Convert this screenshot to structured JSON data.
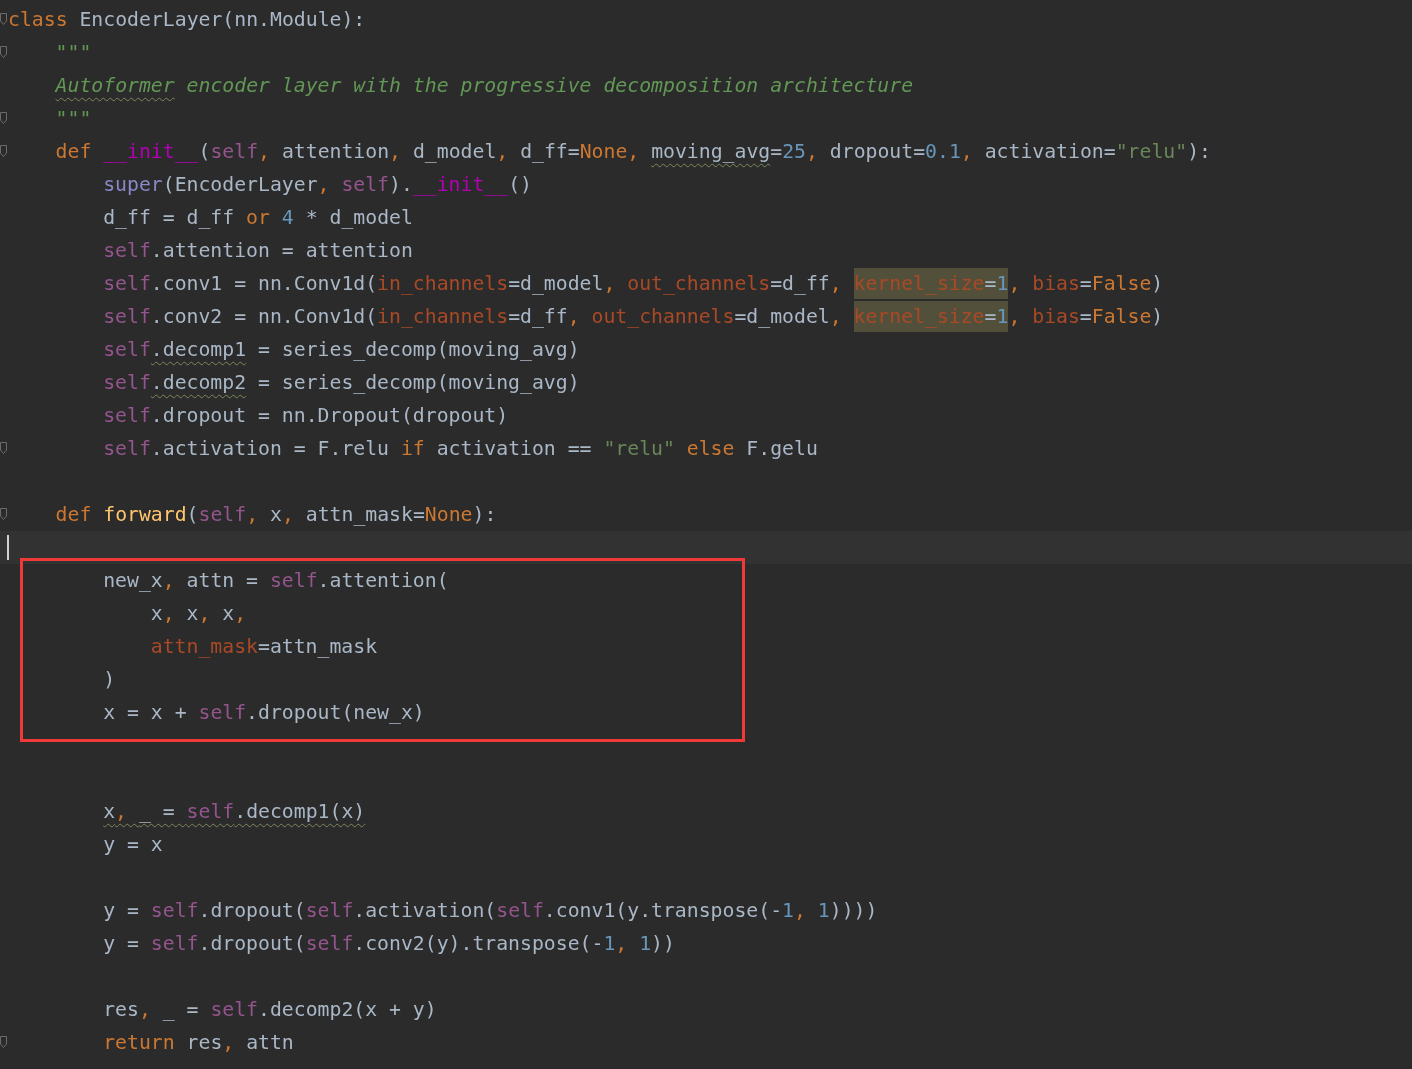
{
  "editor": {
    "lines": [
      {
        "kind": "line",
        "current": false,
        "fold": true,
        "tokens": [
          {
            "kind": "kw",
            "text": "class"
          },
          {
            "kind": "plain",
            "text": " EncoderLayer(nn.Module):"
          }
        ],
        "children": [
          {
            "kind": "line",
            "current": false,
            "fold": true,
            "tokens": [
              {
                "kind": "doc",
                "text": "\"\"\""
              }
            ]
          },
          {
            "kind": "line",
            "current": false,
            "fold": false,
            "tokens": [
              {
                "kind": "doc",
                "text": "Autoformer",
                "warning": true
              },
              {
                "kind": "doc",
                "text": " encoder layer with the progressive decomposition architecture"
              }
            ]
          },
          {
            "kind": "line",
            "current": false,
            "fold": true,
            "tokens": [
              {
                "kind": "doc",
                "text": "\"\"\""
              }
            ]
          },
          {
            "kind": "line",
            "current": false,
            "fold": true,
            "tokens": [
              {
                "kind": "kw",
                "text": "def "
              },
              {
                "kind": "dunder",
                "text": "__init__"
              },
              {
                "kind": "plain",
                "text": "("
              },
              {
                "kind": "self",
                "text": "self"
              },
              {
                "kind": "kw",
                "text": ", "
              },
              {
                "kind": "plain",
                "text": "attention"
              },
              {
                "kind": "kw",
                "text": ", "
              },
              {
                "kind": "plain",
                "text": "d_model"
              },
              {
                "kind": "kw",
                "text": ", "
              },
              {
                "kind": "plain",
                "text": "d_ff="
              },
              {
                "kind": "kw",
                "text": "None"
              },
              {
                "kind": "kw",
                "text": ", "
              },
              {
                "kind": "plain",
                "text": "moving_avg",
                "warning": true
              },
              {
                "kind": "plain",
                "text": "="
              },
              {
                "kind": "num",
                "text": "25"
              },
              {
                "kind": "kw",
                "text": ", "
              },
              {
                "kind": "plain",
                "text": "dropout="
              },
              {
                "kind": "num",
                "text": "0.1"
              },
              {
                "kind": "kw",
                "text": ", "
              },
              {
                "kind": "plain",
                "text": "activation="
              },
              {
                "kind": "str",
                "text": "\"relu\""
              },
              {
                "kind": "plain",
                "text": "):"
              }
            ],
            "children": [
              {
                "kind": "line",
                "current": false,
                "fold": false,
                "tokens": [
                  {
                    "kind": "builtin",
                    "text": "super"
                  },
                  {
                    "kind": "plain",
                    "text": "(EncoderLayer"
                  },
                  {
                    "kind": "kw",
                    "text": ", "
                  },
                  {
                    "kind": "self",
                    "text": "self"
                  },
                  {
                    "kind": "plain",
                    "text": ")."
                  },
                  {
                    "kind": "dunder",
                    "text": "__init__"
                  },
                  {
                    "kind": "plain",
                    "text": "()"
                  }
                ]
              },
              {
                "kind": "line",
                "current": false,
                "fold": false,
                "tokens": [
                  {
                    "kind": "plain",
                    "text": "d_ff = d_ff "
                  },
                  {
                    "kind": "kw",
                    "text": "or "
                  },
                  {
                    "kind": "num",
                    "text": "4"
                  },
                  {
                    "kind": "plain",
                    "text": " * d_model"
                  }
                ]
              },
              {
                "kind": "line",
                "current": false,
                "fold": false,
                "tokens": [
                  {
                    "kind": "self",
                    "text": "self"
                  },
                  {
                    "kind": "plain",
                    "text": ".attention = attention"
                  }
                ]
              },
              {
                "kind": "line",
                "current": false,
                "fold": false,
                "tokens": [
                  {
                    "kind": "self",
                    "text": "self"
                  },
                  {
                    "kind": "plain",
                    "text": ".conv1 = nn.Conv1d("
                  },
                  {
                    "kind": "param",
                    "text": "in_channels"
                  },
                  {
                    "kind": "plain",
                    "text": "=d_model"
                  },
                  {
                    "kind": "kw",
                    "text": ", "
                  },
                  {
                    "kind": "param",
                    "text": "out_channels"
                  },
                  {
                    "kind": "plain",
                    "text": "=d_ff"
                  },
                  {
                    "kind": "kw",
                    "text": ", "
                  },
                  {
                    "kind": "param",
                    "text": "kernel_size",
                    "highlighted": true
                  },
                  {
                    "kind": "plain",
                    "text": "=",
                    "highlighted": true
                  },
                  {
                    "kind": "num",
                    "text": "1",
                    "highlighted": true
                  },
                  {
                    "kind": "kw",
                    "text": ", "
                  },
                  {
                    "kind": "param",
                    "text": "bias"
                  },
                  {
                    "kind": "plain",
                    "text": "="
                  },
                  {
                    "kind": "kw",
                    "text": "False"
                  },
                  {
                    "kind": "plain",
                    "text": ")"
                  }
                ]
              },
              {
                "kind": "line",
                "current": false,
                "fold": false,
                "tokens": [
                  {
                    "kind": "self",
                    "text": "self"
                  },
                  {
                    "kind": "plain",
                    "text": ".conv2 = nn.Conv1d("
                  },
                  {
                    "kind": "param",
                    "text": "in_channels"
                  },
                  {
                    "kind": "plain",
                    "text": "=d_ff"
                  },
                  {
                    "kind": "kw",
                    "text": ", "
                  },
                  {
                    "kind": "param",
                    "text": "out_channels"
                  },
                  {
                    "kind": "plain",
                    "text": "=d_model"
                  },
                  {
                    "kind": "kw",
                    "text": ", "
                  },
                  {
                    "kind": "param",
                    "text": "kernel_size",
                    "highlighted": true
                  },
                  {
                    "kind": "plain",
                    "text": "=",
                    "highlighted": true
                  },
                  {
                    "kind": "num",
                    "text": "1",
                    "highlighted": true
                  },
                  {
                    "kind": "kw",
                    "text": ", "
                  },
                  {
                    "kind": "param",
                    "text": "bias"
                  },
                  {
                    "kind": "plain",
                    "text": "="
                  },
                  {
                    "kind": "kw",
                    "text": "False"
                  },
                  {
                    "kind": "plain",
                    "text": ")"
                  }
                ]
              },
              {
                "kind": "line",
                "current": false,
                "fold": false,
                "tokens": [
                  {
                    "kind": "self",
                    "text": "self"
                  },
                  {
                    "kind": "plain",
                    "text": ".decomp1",
                    "warning": true
                  },
                  {
                    "kind": "plain",
                    "text": " = series_decomp(moving_avg)"
                  }
                ]
              },
              {
                "kind": "line",
                "current": false,
                "fold": false,
                "tokens": [
                  {
                    "kind": "self",
                    "text": "self"
                  },
                  {
                    "kind": "plain",
                    "text": ".decomp2",
                    "warning": true
                  },
                  {
                    "kind": "plain",
                    "text": " = series_decomp(moving_avg)"
                  }
                ]
              },
              {
                "kind": "line",
                "current": false,
                "fold": false,
                "tokens": [
                  {
                    "kind": "self",
                    "text": "self"
                  },
                  {
                    "kind": "plain",
                    "text": ".dropout = nn.Dropout(dropout)"
                  }
                ]
              },
              {
                "kind": "line",
                "current": false,
                "fold": true,
                "tokens": [
                  {
                    "kind": "self",
                    "text": "self"
                  },
                  {
                    "kind": "plain",
                    "text": ".activation = F.relu "
                  },
                  {
                    "kind": "kw",
                    "text": "if"
                  },
                  {
                    "kind": "plain",
                    "text": " activation == "
                  },
                  {
                    "kind": "str",
                    "text": "\"relu\""
                  },
                  {
                    "kind": "kw",
                    "text": " else"
                  },
                  {
                    "kind": "plain",
                    "text": " F.gelu"
                  }
                ]
              },
              {
                "kind": "line",
                "current": false,
                "fold": false
              }
            ]
          },
          {
            "kind": "line",
            "current": false,
            "fold": true,
            "tokens": [
              {
                "kind": "kw",
                "text": "def "
              },
              {
                "kind": "fn",
                "text": "forward"
              },
              {
                "kind": "plain",
                "text": "("
              },
              {
                "kind": "self",
                "text": "self"
              },
              {
                "kind": "kw",
                "text": ", "
              },
              {
                "kind": "plain",
                "text": "x"
              },
              {
                "kind": "kw",
                "text": ", "
              },
              {
                "kind": "plain",
                "text": "attn_mask="
              },
              {
                "kind": "kw",
                "text": "None"
              },
              {
                "kind": "plain",
                "text": "):"
              }
            ],
            "children": [
              {
                "kind": "line",
                "current": true,
                "fold": false
              },
              {
                "kind": "highlight_box",
                "children": [
                  {
                    "kind": "line",
                    "current": false,
                    "fold": false,
                    "tokens": [
                      {
                        "kind": "plain",
                        "text": "new_x"
                      },
                      {
                        "kind": "kw",
                        "text": ", "
                      },
                      {
                        "kind": "plain",
                        "text": "attn = "
                      },
                      {
                        "kind": "self",
                        "text": "self"
                      },
                      {
                        "kind": "plain",
                        "text": ".attention("
                      }
                    ],
                    "children": [
                      {
                        "kind": "line",
                        "current": false,
                        "fold": false,
                        "tokens": [
                          {
                            "kind": "plain",
                            "text": "x"
                          },
                          {
                            "kind": "kw",
                            "text": ", "
                          },
                          {
                            "kind": "plain",
                            "text": "x"
                          },
                          {
                            "kind": "kw",
                            "text": ", "
                          },
                          {
                            "kind": "plain",
                            "text": "x"
                          },
                          {
                            "kind": "kw",
                            "text": ","
                          }
                        ]
                      },
                      {
                        "kind": "line",
                        "current": false,
                        "fold": false,
                        "tokens": [
                          {
                            "kind": "param",
                            "text": "attn_mask"
                          },
                          {
                            "kind": "plain",
                            "text": "=attn_mask"
                          }
                        ]
                      }
                    ]
                  },
                  {
                    "kind": "line",
                    "current": false,
                    "fold": false,
                    "tokens": [
                      {
                        "kind": "plain",
                        "text": ")"
                      }
                    ]
                  },
                  {
                    "kind": "line",
                    "current": false,
                    "fold": false,
                    "tokens": [
                      {
                        "kind": "plain",
                        "text": "x = x + "
                      },
                      {
                        "kind": "self",
                        "text": "self"
                      },
                      {
                        "kind": "plain",
                        "text": ".dropout(new_x)"
                      }
                    ]
                  }
                ]
              },
              {
                "kind": "line",
                "current": false,
                "fold": false
              },
              {
                "kind": "line",
                "current": false,
                "fold": false
              },
              {
                "kind": "line",
                "current": false,
                "fold": false,
                "tokens": [
                  {
                    "kind": "plain",
                    "text": "x",
                    "warning": true
                  },
                  {
                    "kind": "kw",
                    "text": ", ",
                    "warning": true
                  },
                  {
                    "kind": "plain",
                    "text": "_ = ",
                    "warning": true
                  },
                  {
                    "kind": "self",
                    "text": "self",
                    "warning": true
                  },
                  {
                    "kind": "plain",
                    "text": ".decomp1(x)",
                    "warning": true
                  }
                ]
              },
              {
                "kind": "line",
                "current": false,
                "fold": false,
                "tokens": [
                  {
                    "kind": "plain",
                    "text": "y = x"
                  }
                ]
              },
              {
                "kind": "line",
                "current": false,
                "fold": false
              },
              {
                "kind": "line",
                "current": false,
                "fold": false,
                "tokens": [
                  {
                    "kind": "plain",
                    "text": "y = "
                  },
                  {
                    "kind": "self",
                    "text": "self"
                  },
                  {
                    "kind": "plain",
                    "text": ".dropout("
                  },
                  {
                    "kind": "self",
                    "text": "self"
                  },
                  {
                    "kind": "plain",
                    "text": ".activation("
                  },
                  {
                    "kind": "self",
                    "text": "self"
                  },
                  {
                    "kind": "plain",
                    "text": ".conv1(y.transpose(-"
                  },
                  {
                    "kind": "num",
                    "text": "1"
                  },
                  {
                    "kind": "kw",
                    "text": ", "
                  },
                  {
                    "kind": "num",
                    "text": "1"
                  },
                  {
                    "kind": "plain",
                    "text": "))))"
                  }
                ]
              },
              {
                "kind": "line",
                "current": false,
                "fold": false,
                "tokens": [
                  {
                    "kind": "plain",
                    "text": "y = "
                  },
                  {
                    "kind": "self",
                    "text": "self"
                  },
                  {
                    "kind": "plain",
                    "text": ".dropout("
                  },
                  {
                    "kind": "self",
                    "text": "self"
                  },
                  {
                    "kind": "plain",
                    "text": ".conv2(y).transpose(-"
                  },
                  {
                    "kind": "num",
                    "text": "1"
                  },
                  {
                    "kind": "kw",
                    "text": ", "
                  },
                  {
                    "kind": "num",
                    "text": "1"
                  },
                  {
                    "kind": "plain",
                    "text": "))"
                  }
                ]
              },
              {
                "kind": "line",
                "current": false,
                "fold": false
              },
              {
                "kind": "line",
                "current": false,
                "fold": false,
                "tokens": [
                  {
                    "kind": "plain",
                    "text": "res"
                  },
                  {
                    "kind": "kw",
                    "text": ", "
                  },
                  {
                    "kind": "plain",
                    "text": "_ = "
                  },
                  {
                    "kind": "self",
                    "text": "self"
                  },
                  {
                    "kind": "plain",
                    "text": ".decomp2(x + y)"
                  }
                ]
              },
              {
                "kind": "line",
                "current": false,
                "fold": true,
                "tokens": [
                  {
                    "kind": "kw",
                    "text": "return"
                  },
                  {
                    "kind": "plain",
                    "text": " res"
                  },
                  {
                    "kind": "kw",
                    "text": ", "
                  },
                  {
                    "kind": "plain",
                    "text": "attn"
                  }
                ]
              }
            ]
          }
        ]
      }
    ]
  }
}
